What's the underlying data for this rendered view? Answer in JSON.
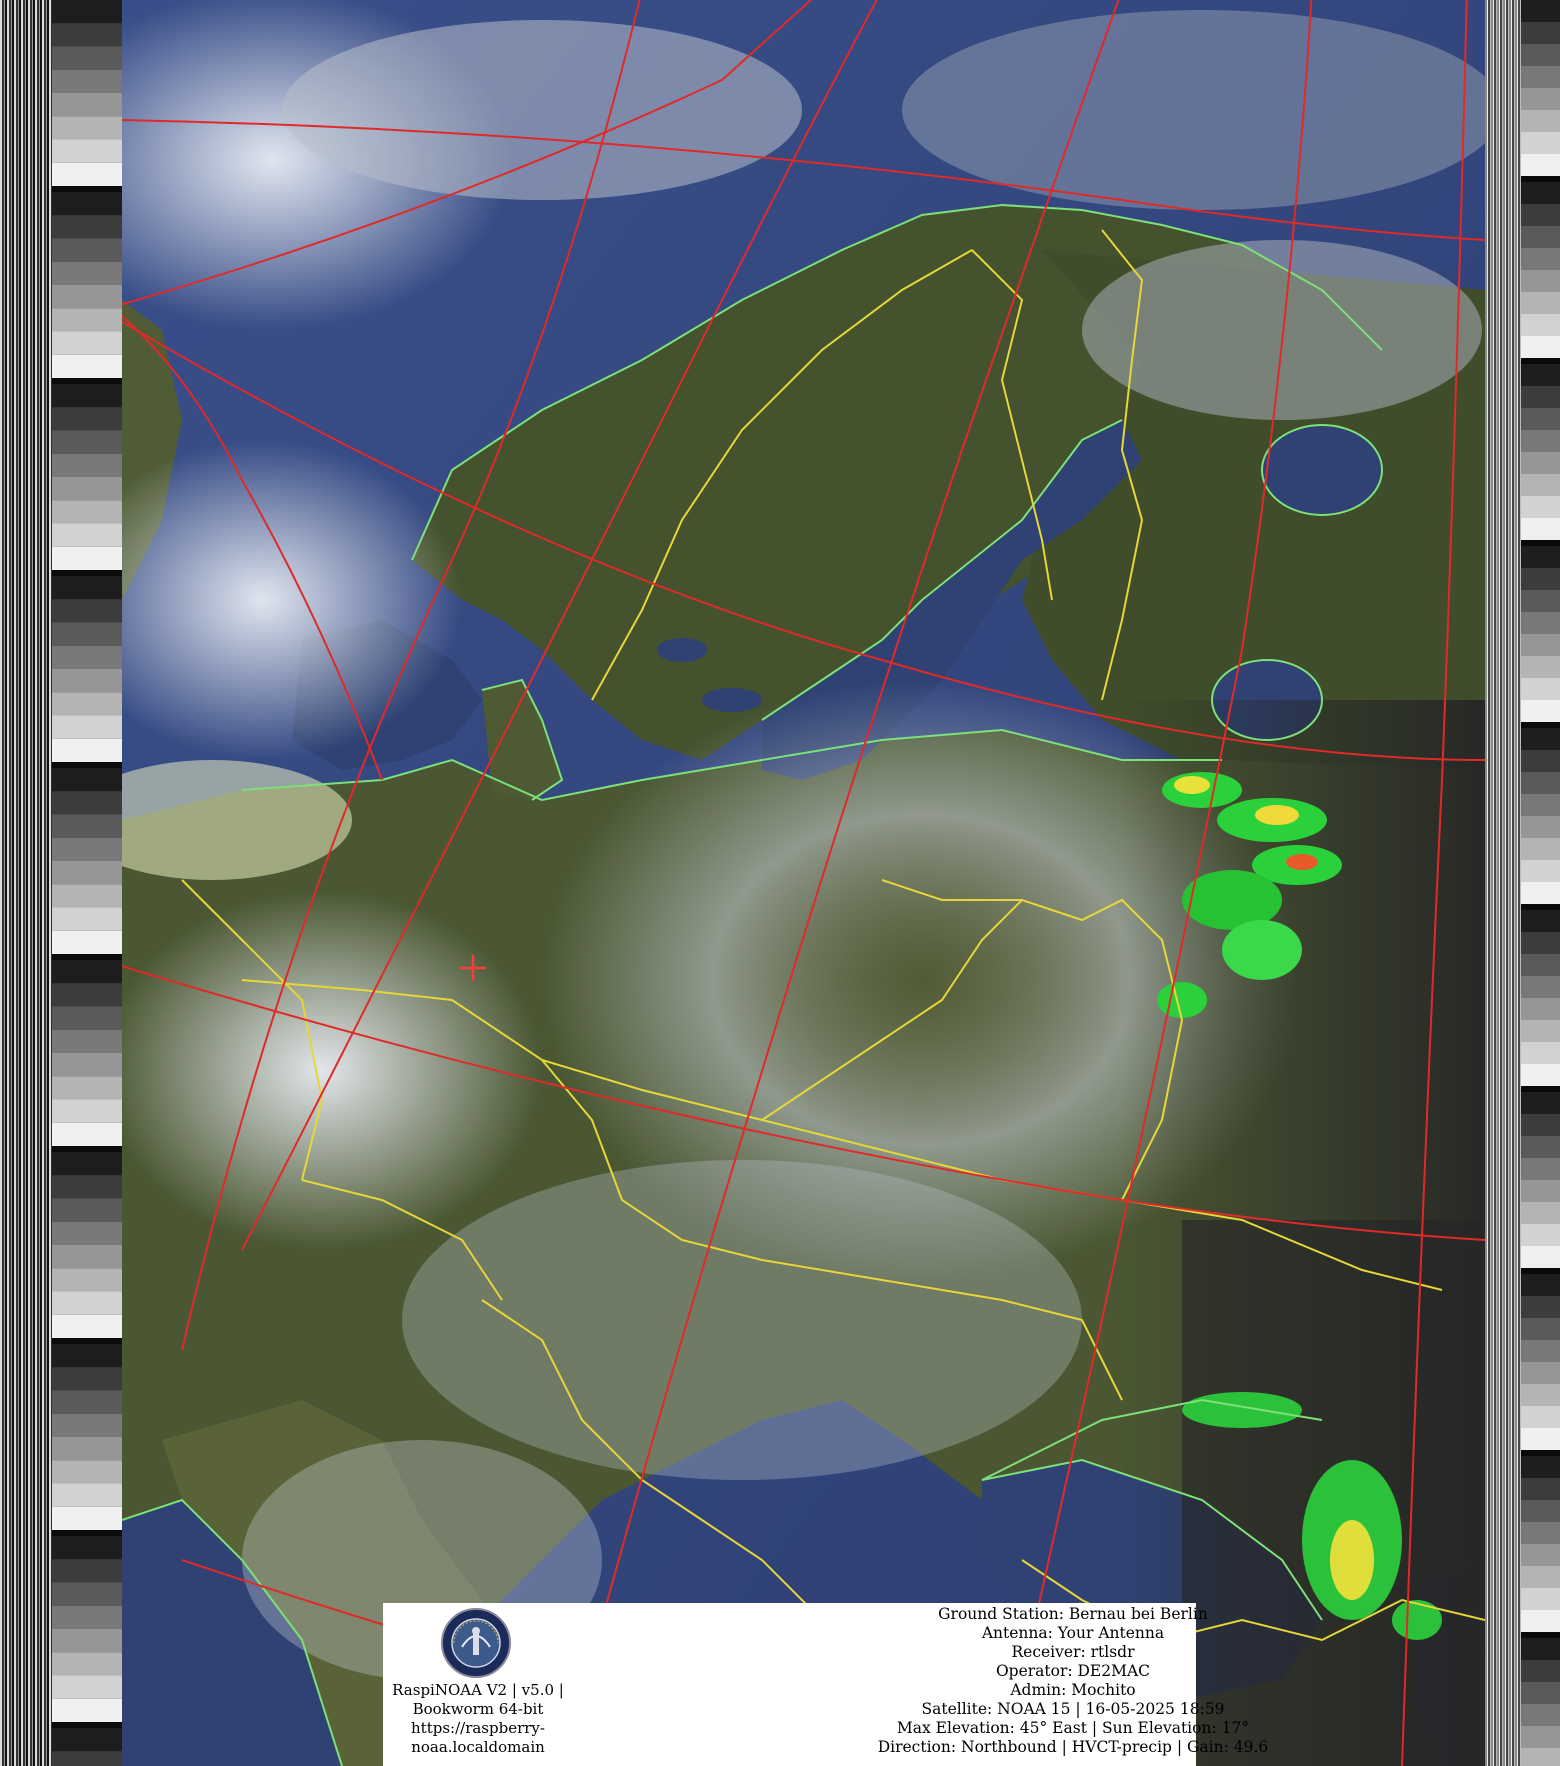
{
  "info": {
    "software_line1": "RaspiNOAA V2 | v5.0 |",
    "software_line2": "Bookworm 64-bit",
    "software_line3": "https://raspberry-",
    "software_line4": "noaa.localdomain",
    "ground_station": "Ground Station: Bernau bei Berlin",
    "antenna": "Antenna: Your Antenna",
    "receiver": "Receiver: rtlsdr",
    "operator": "Operator: DE2MAC",
    "admin": "Admin: Mochito",
    "satellite": "Satellite: NOAA 15 | 16-05-2025 18:59",
    "elevation": "Max Elevation: 45° East | Sun Elevation: 17°",
    "direction": "Direction: Northbound | HVCT-precip | Gain: 49.6"
  },
  "colors": {
    "coastline": "#7de07a",
    "border": "#e6d63a",
    "graticule": "#e02a2a",
    "precip_light": "#2bd13a",
    "precip_medium": "#e7e13a",
    "precip_heavy": "#e85a2a"
  }
}
